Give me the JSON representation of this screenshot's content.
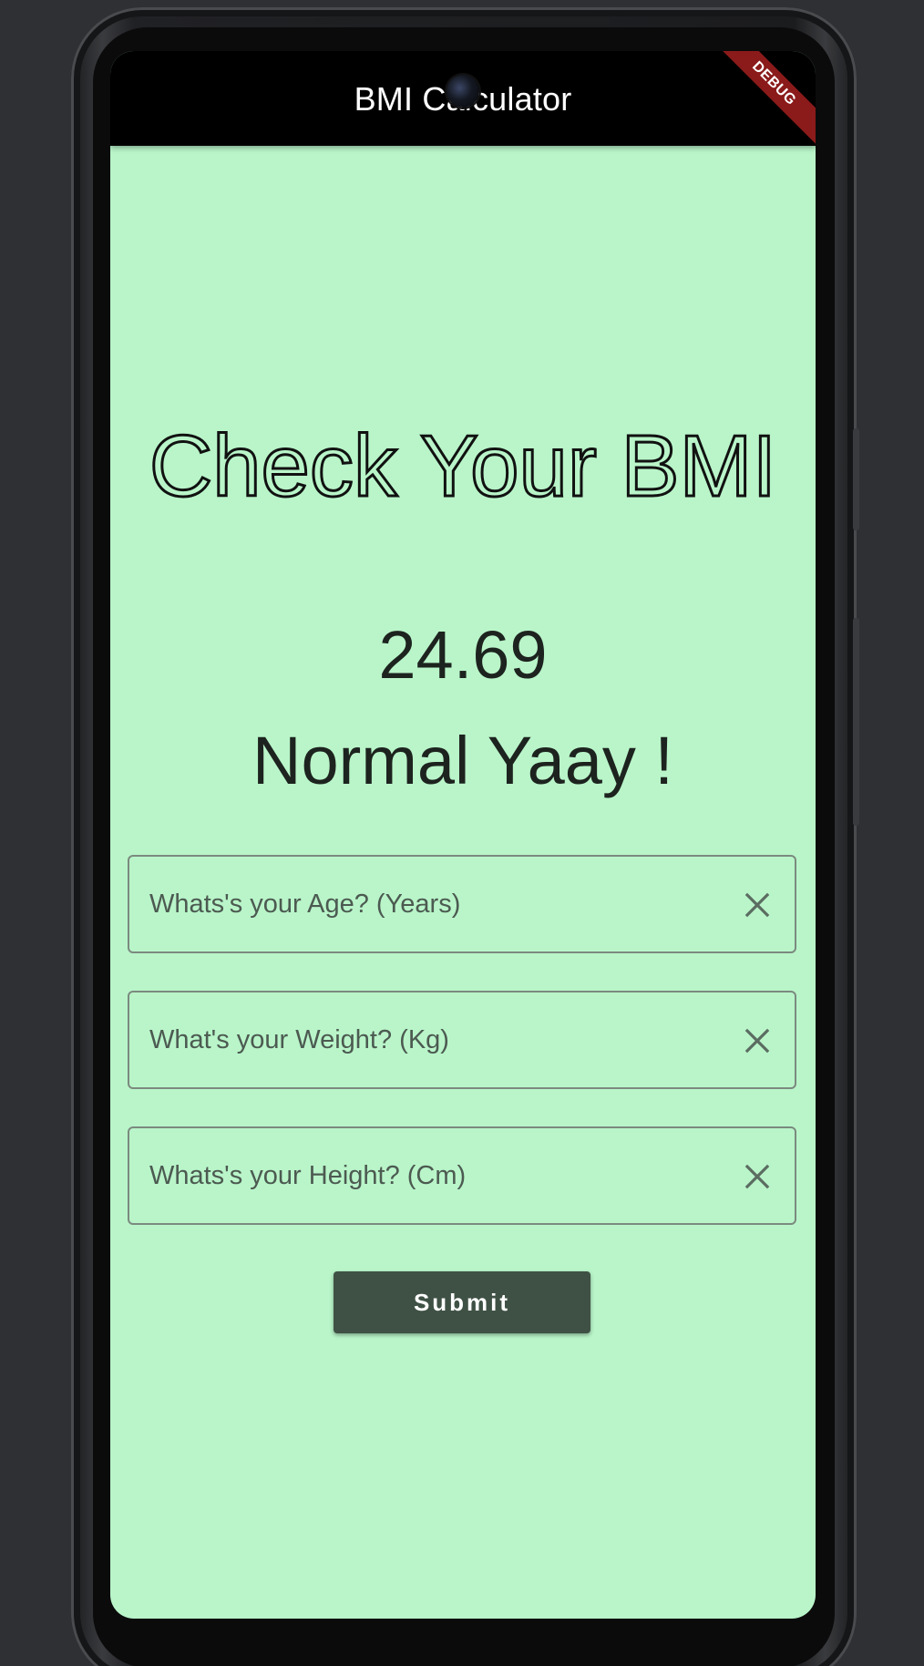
{
  "app_bar": {
    "title": "BMI Calculator",
    "debug_banner": "DEBUG"
  },
  "main": {
    "heading": "Check Your BMI",
    "bmi_value": "24.69",
    "bmi_status": "Normal Yaay !"
  },
  "form": {
    "age": {
      "placeholder": "Whats's your Age? (Years)",
      "value": "",
      "clear_icon": "close-icon"
    },
    "weight": {
      "placeholder": "What's your Weight? (Kg)",
      "value": "",
      "clear_icon": "close-icon"
    },
    "height": {
      "placeholder": "Whats's your Height? (Cm)",
      "value": "",
      "clear_icon": "close-icon"
    },
    "submit_label": "Submit"
  },
  "colors": {
    "background": "#b9f5c9",
    "app_bar": "#000000",
    "button": "#3f5145",
    "debug_banner": "#8b1a1a"
  }
}
